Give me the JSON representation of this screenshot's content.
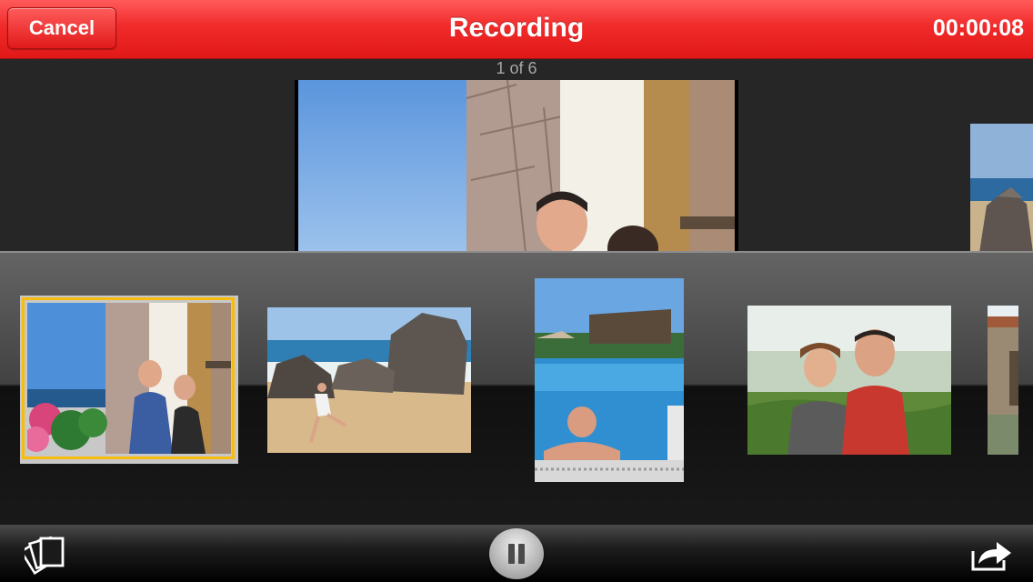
{
  "header": {
    "cancel_label": "Cancel",
    "title": "Recording",
    "timer": "00:00:08"
  },
  "viewer": {
    "counter": "1 of 6"
  },
  "colors": {
    "header_red": "#f12a2a",
    "selection_border": "#f7bc0d",
    "background": "#262626"
  },
  "icons": {
    "library": "photo-stack-icon",
    "pause": "pause-icon",
    "share": "share-icon"
  }
}
